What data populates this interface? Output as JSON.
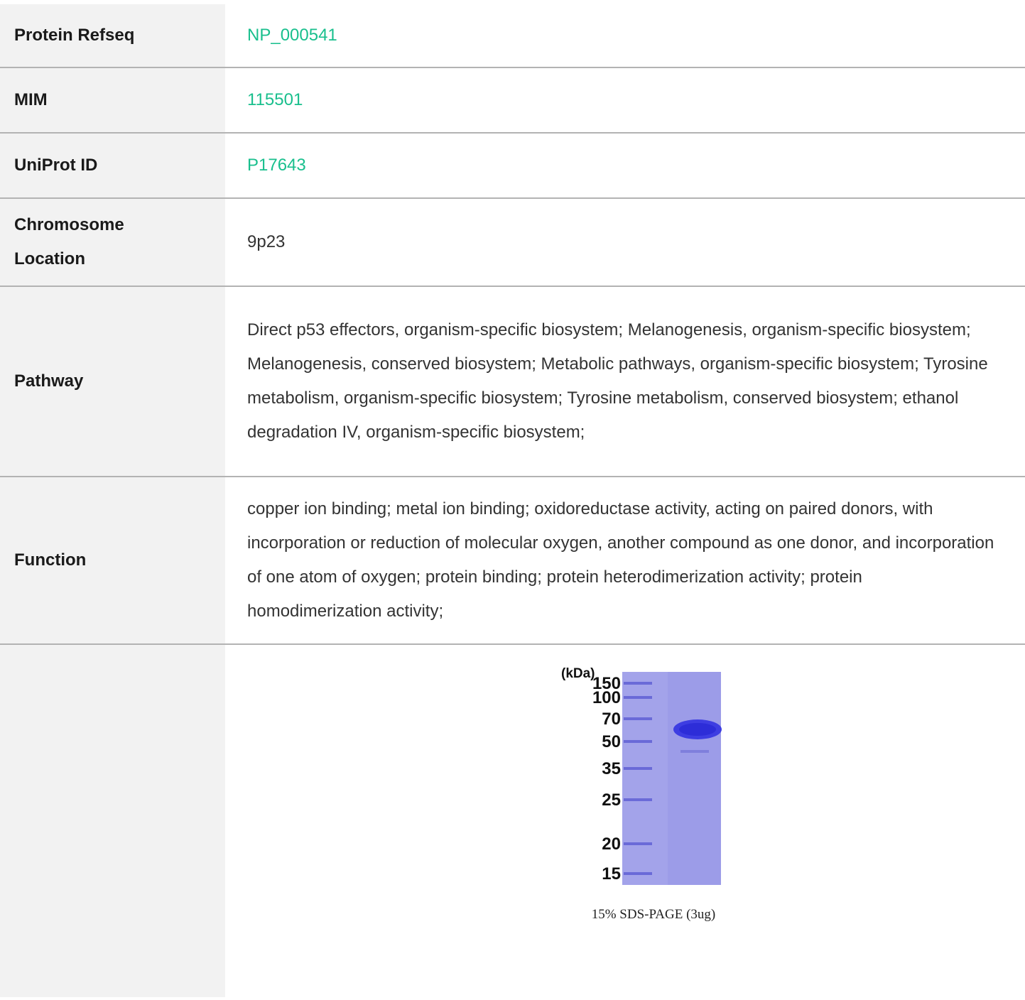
{
  "rows": [
    {
      "label": "Protein Refseq",
      "value": "NP_000541",
      "link": true
    },
    {
      "label": "MIM",
      "value": "115501",
      "link": true
    },
    {
      "label": "UniProt ID",
      "value": "P17643",
      "link": true
    },
    {
      "label": "Chromosome Location",
      "value": "9p23",
      "link": false
    },
    {
      "label": "Pathway",
      "value": "Direct p53 effectors, organism-specific biosystem; Melanogenesis, organism-specific biosystem; Melanogenesis, conserved biosystem; Metabolic pathways, organism-specific biosystem; Tyrosine metabolism, organism-specific biosystem; Tyrosine metabolism, conserved biosystem; ethanol degradation IV, organism-specific biosystem;",
      "link": false
    },
    {
      "label": "Function",
      "value": "copper ion binding; metal ion binding; oxidoreductase activity, acting on paired donors, with incorporation or reduction of molecular oxygen, another compound as one donor, and incorporation of one atom of oxygen; protein binding; protein heterodimerization activity; protein homodimerization activity;",
      "link": false
    }
  ],
  "gel": {
    "unit_label": "(kDa)",
    "markers": [
      "150",
      "100",
      "70",
      "50",
      "35",
      "25",
      "20",
      "15"
    ],
    "caption": "15% SDS-PAGE (3ug)"
  },
  "colors": {
    "link": "#19bf8d",
    "label_bg": "#f2f2f2",
    "gel_bg": "#9a9ae6",
    "band": "#3a3ae0"
  }
}
